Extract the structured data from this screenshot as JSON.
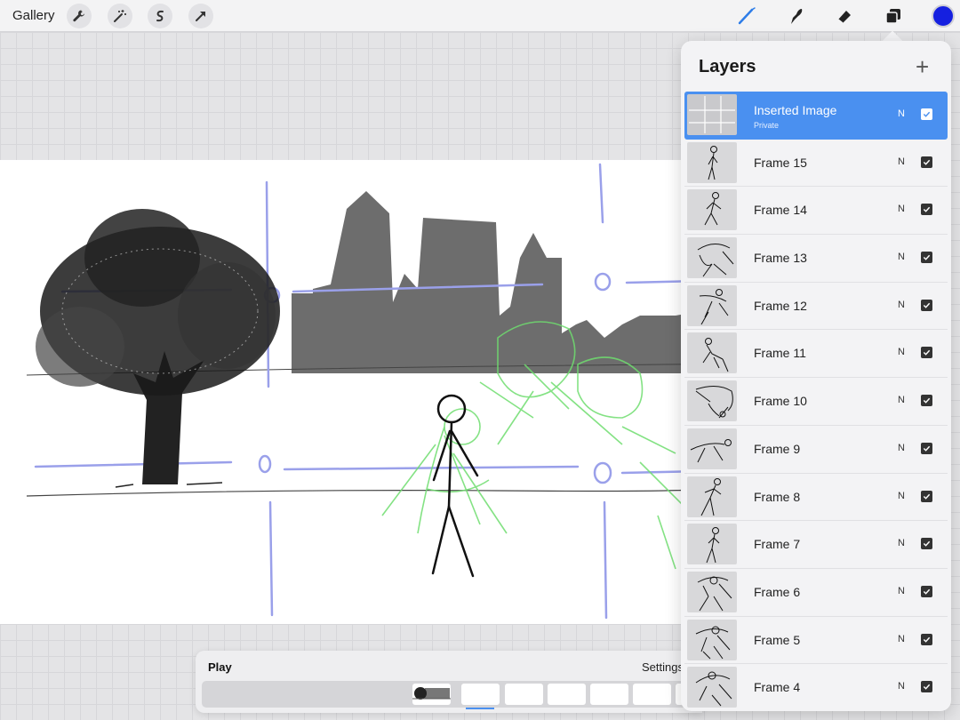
{
  "toolbar": {
    "gallery_label": "Gallery",
    "left_tools": [
      "wrench-icon",
      "magic-wand-icon",
      "selection-icon",
      "transform-arrow-icon"
    ],
    "right_tools": [
      "brush-icon",
      "smudge-icon",
      "eraser-icon",
      "layers-icon"
    ],
    "active_tool": "brush-icon",
    "current_color": "#1520e0",
    "accent_color": "#4a90f0"
  },
  "layers": {
    "title": "Layers",
    "add_label": "+",
    "items": [
      {
        "name": "Inserted Image",
        "sub": "Private",
        "blend": "N",
        "visible": true,
        "selected": true
      },
      {
        "name": "Frame 15",
        "blend": "N",
        "visible": true
      },
      {
        "name": "Frame 14",
        "blend": "N",
        "visible": true
      },
      {
        "name": "Frame 13",
        "blend": "N",
        "visible": true
      },
      {
        "name": "Frame 12",
        "blend": "N",
        "visible": true
      },
      {
        "name": "Frame 11",
        "blend": "N",
        "visible": true
      },
      {
        "name": "Frame 10",
        "blend": "N",
        "visible": true
      },
      {
        "name": "Frame 9",
        "blend": "N",
        "visible": true
      },
      {
        "name": "Frame 8",
        "blend": "N",
        "visible": true
      },
      {
        "name": "Frame 7",
        "blend": "N",
        "visible": true
      },
      {
        "name": "Frame 6",
        "blend": "N",
        "visible": true
      },
      {
        "name": "Frame 5",
        "blend": "N",
        "visible": true
      },
      {
        "name": "Frame 4",
        "blend": "N",
        "visible": true
      }
    ]
  },
  "animation": {
    "play_label": "Play",
    "settings_label": "Settings"
  }
}
